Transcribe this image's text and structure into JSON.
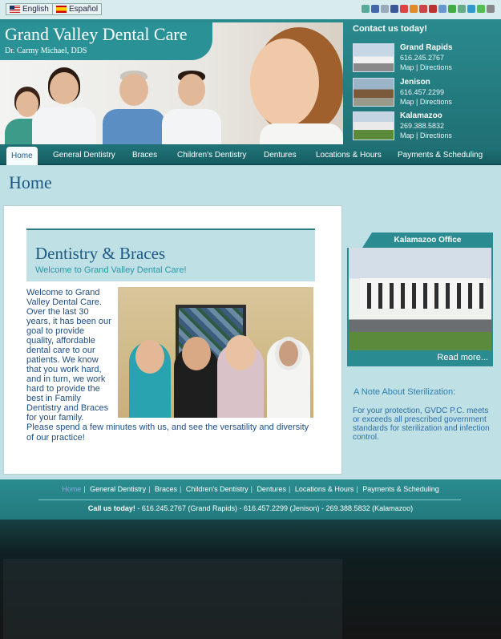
{
  "language": {
    "english": "English",
    "spanish": "Español"
  },
  "social_icons": [
    "twitter-icon",
    "share-icon",
    "rss-icon",
    "facebook-icon",
    "google-icon",
    "email-icon",
    "myspace-icon",
    "bookmark-icon",
    "digg-icon",
    "stumble-icon",
    "print-icon",
    "delicious-icon",
    "yahoo-icon",
    "more-icon"
  ],
  "header": {
    "title": "Grand Valley Dental Care",
    "subtitle": "Dr. Carmy Michael, DDS"
  },
  "contact": {
    "title": "Contact us today!",
    "offices": [
      {
        "name": "Grand Rapids",
        "phone": "616.245.2767",
        "links": "Map | Directions"
      },
      {
        "name": "Jenison",
        "phone": "616.457.2299",
        "links": "Map | Directions"
      },
      {
        "name": "Kalamazoo",
        "phone": "269.388.5832",
        "links": "Map | Directions"
      }
    ]
  },
  "nav": {
    "items": [
      "Home",
      "General Dentistry",
      "Braces",
      "Children's Dentistry",
      "Dentures",
      "Locations & Hours",
      "Payments & Scheduling"
    ]
  },
  "page": {
    "title": "Home"
  },
  "main": {
    "section_title": "Dentistry & Braces",
    "section_subtitle": "Welcome to Grand Valley Dental Care!",
    "intro": "Welcome to Grand Valley Dental Care. Over the last 30 years, it has been our goal to provide quality, affordable dental care to our patients. We know that you work hard, and in turn, we work hard to provide the best in Family Dentistry and Braces for your family.",
    "closing": "Please spend a few minutes with us, and see the versatility and diversity of our practice!"
  },
  "sidebar": {
    "office_title": "Kalamazoo Office",
    "read_more": "Read more...",
    "note_title": "A Note About Sterilization:",
    "note_body": "For your protection, GVDC P.C. meets or exceeds all prescribed government standards for sterilization and infection control."
  },
  "footer": {
    "nav": [
      "Home",
      "General Dentistry",
      "Braces",
      "Children's Dentistry",
      "Dentures",
      "Locations & Hours",
      "Payments & Scheduling"
    ],
    "call_label": "Call us today!",
    "call_text": " - 616.245.2767 (Grand Rapids) - 616.457.2299 (Jenison) - 269.388.5832 (Kalamazoo)"
  }
}
